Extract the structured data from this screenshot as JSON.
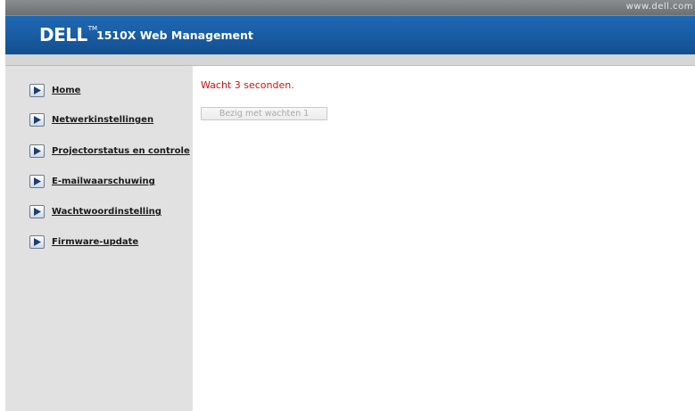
{
  "top_bar": {
    "site_url": "www.dell.com"
  },
  "header": {
    "logo_text": "DELL",
    "logo_tm": "TM",
    "app_title": "1510X Web Management"
  },
  "sidebar": {
    "items": [
      {
        "label": "Home",
        "icon": "play-arrow-icon"
      },
      {
        "label": "Netwerkinstellingen",
        "icon": "play-arrow-icon"
      },
      {
        "label": "Projectorstatus en controle",
        "icon": "play-arrow-icon"
      },
      {
        "label": "E-mailwaarschuwing",
        "icon": "play-arrow-icon"
      },
      {
        "label": "Wachtwoordinstelling",
        "icon": "play-arrow-icon"
      },
      {
        "label": "Firmware-update",
        "icon": "play-arrow-icon"
      }
    ]
  },
  "main": {
    "status_message": "Wacht 3 seconden.",
    "wait_button_label": "Bezig met wachten 1"
  },
  "colors": {
    "header_blue": "#1a5ea6",
    "sidebar_gray": "#e1e1e1",
    "status_red": "#cc1111"
  }
}
